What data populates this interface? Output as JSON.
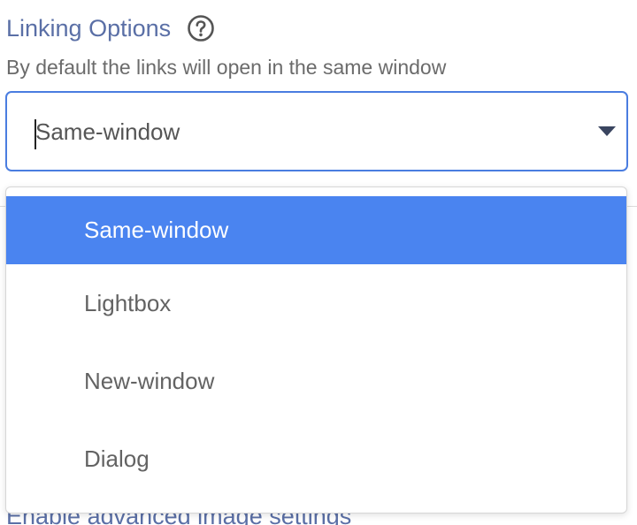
{
  "linking_options": {
    "title": "Linking Options",
    "help_icon": "question-circle-icon",
    "description": "By default the links will open in the same window",
    "select": {
      "value": "Same-window",
      "arrow_icon": "caret-down-icon"
    },
    "options": [
      {
        "label": "Same-window",
        "selected": true
      },
      {
        "label": "Lightbox",
        "selected": false
      },
      {
        "label": "New-window",
        "selected": false
      },
      {
        "label": "Dialog",
        "selected": false
      }
    ]
  },
  "next_section": {
    "title": "Enable advanced image settings"
  },
  "colors": {
    "accent": "#4a84f0",
    "focus_border": "#4a7de0",
    "title": "#5a6fa6",
    "text": "#636363"
  }
}
